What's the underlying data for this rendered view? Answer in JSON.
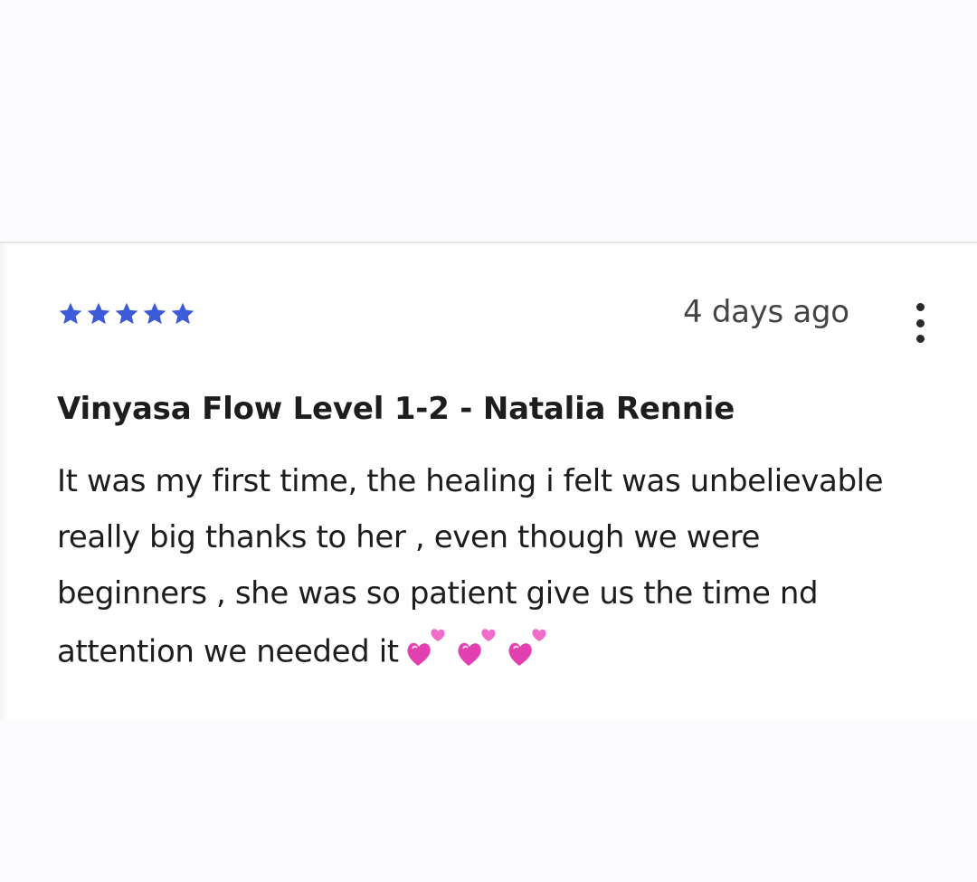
{
  "review": {
    "rating": 5,
    "rating_max": 5,
    "star_color": "#3d5bd9",
    "timestamp": "4 days ago",
    "more_icon": "vertical-ellipsis-icon",
    "class_title": "Vinyasa Flow Level 1-2 - Natalia Rennie",
    "body_lines": [
      "It was my first time, the healing i felt was unbelievable",
      "really big thanks to her , even though we were",
      "beginners , she was so patient give us the time nd",
      "attention we needed it"
    ],
    "emoji": [
      "two-hearts-icon",
      "two-hearts-icon",
      "two-hearts-icon"
    ],
    "heart_color": "#e23fb0"
  }
}
